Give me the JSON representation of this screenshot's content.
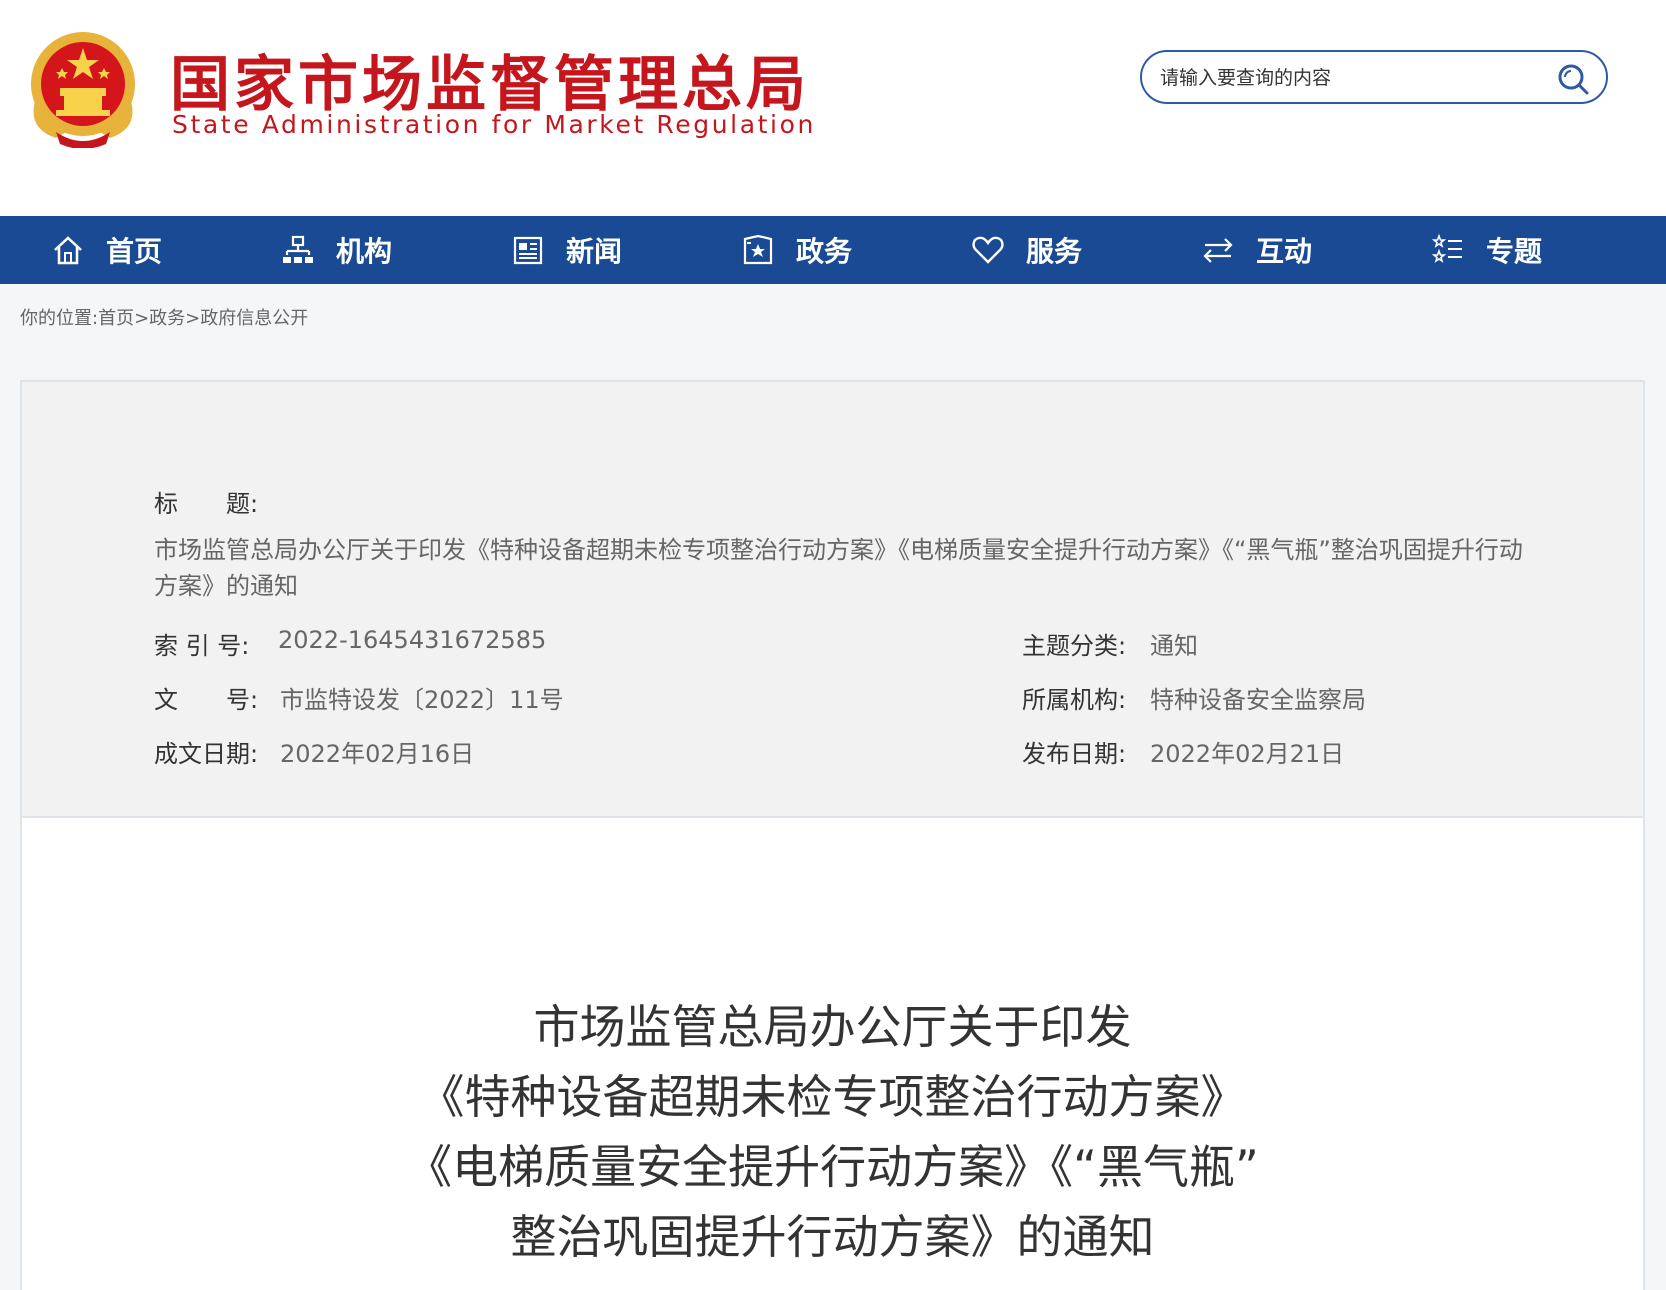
{
  "header": {
    "title": "国家市场监督管理总局",
    "subtitle": "State Administration for Market Regulation",
    "search_placeholder": "请输入要查询的内容"
  },
  "nav": {
    "items": [
      {
        "label": "首页",
        "icon": "home-icon"
      },
      {
        "label": "机构",
        "icon": "org-chart-icon"
      },
      {
        "label": "新闻",
        "icon": "newspaper-icon"
      },
      {
        "label": "政务",
        "icon": "government-affairs-icon"
      },
      {
        "label": "服务",
        "icon": "heart-icon"
      },
      {
        "label": "互动",
        "icon": "exchange-arrows-icon"
      },
      {
        "label": "专题",
        "icon": "topic-list-icon"
      }
    ]
  },
  "breadcrumb": "你的位置:首页>政务>政府信息公开",
  "meta": {
    "title_label": "标　　题:",
    "title_value": "市场监管总局办公厅关于印发《特种设备超期未检专项整治行动方案》《电梯质量安全提升行动方案》《“黑气瓶”整治巩固提升行动方案》的通知",
    "index_label": "索 引 号:",
    "index_value": "2022-1645431672585",
    "doc_no_label": "文　　号:",
    "doc_no_value": "市监特设发〔2022〕11号",
    "written_date_label": "成文日期:",
    "written_date_value": "2022年02月16日",
    "topic_label": "主题分类:",
    "topic_value": "通知",
    "agency_label": "所属机构:",
    "agency_value": "特种设备安全监察局",
    "publish_date_label": "发布日期:",
    "publish_date_value": "2022年02月21日"
  },
  "article": {
    "title_lines": [
      "市场监管总局办公厅关于印发",
      "《特种设备超期未检专项整治行动方案》",
      "《电梯质量安全提升行动方案》《“黑气瓶”",
      "整治巩固提升行动方案》的通知"
    ]
  }
}
